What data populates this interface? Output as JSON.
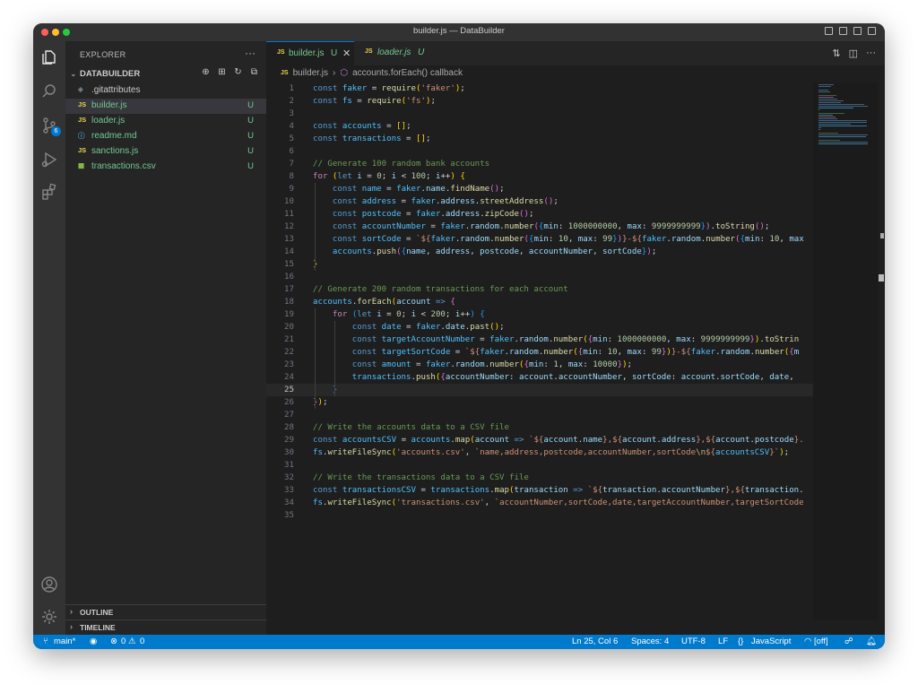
{
  "window": {
    "title": "builder.js — DataBuilder"
  },
  "activity": {
    "scm_badge": "6"
  },
  "sidebar": {
    "header": "EXPLORER",
    "more": "···",
    "folder": "DATABUILDER",
    "files": [
      {
        "name": ".gitattributes",
        "icon": "◈",
        "icon_color": "#6d8086",
        "name_color": "#cccccc",
        "status": ""
      },
      {
        "name": "builder.js",
        "icon": "JS",
        "icon_color": "#e8d44d",
        "name_color": "#73c991",
        "status": "U"
      },
      {
        "name": "loader.js",
        "icon": "JS",
        "icon_color": "#e8d44d",
        "name_color": "#73c991",
        "status": "U"
      },
      {
        "name": "readme.md",
        "icon": "ⓘ",
        "icon_color": "#519aba",
        "name_color": "#73c991",
        "status": "U"
      },
      {
        "name": "sanctions.js",
        "icon": "JS",
        "icon_color": "#e8d44d",
        "name_color": "#73c991",
        "status": "U"
      },
      {
        "name": "transactions.csv",
        "icon": "▦",
        "icon_color": "#8dc149",
        "name_color": "#73c991",
        "status": "U"
      }
    ],
    "outline": "OUTLINE",
    "timeline": "TIMELINE"
  },
  "tabs": [
    {
      "icon": "JS",
      "name": "builder.js",
      "status": "U",
      "close": "✕"
    },
    {
      "icon": "JS",
      "name": "loader.js",
      "status": "U"
    }
  ],
  "breadcrumb": {
    "file_icon": "JS",
    "file": "builder.js",
    "sep": "›",
    "symbol_icon": "⬡",
    "symbol": "accounts.forEach() callback"
  },
  "code": [
    [
      [
        "const ",
        "#569cd6"
      ],
      [
        "faker",
        "#4fc1ff"
      ],
      [
        " = ",
        "#d4d4d4"
      ],
      [
        "require",
        "#dcdcaa"
      ],
      [
        "(",
        "#ffd700"
      ],
      [
        "'faker'",
        "#ce9178"
      ],
      [
        ")",
        "#ffd700"
      ],
      [
        ";",
        "#d4d4d4"
      ]
    ],
    [
      [
        "const ",
        "#569cd6"
      ],
      [
        "fs",
        "#4fc1ff"
      ],
      [
        " = ",
        "#d4d4d4"
      ],
      [
        "require",
        "#dcdcaa"
      ],
      [
        "(",
        "#ffd700"
      ],
      [
        "'fs'",
        "#ce9178"
      ],
      [
        ")",
        "#ffd700"
      ],
      [
        ";",
        "#d4d4d4"
      ]
    ],
    [],
    [
      [
        "const ",
        "#569cd6"
      ],
      [
        "accounts",
        "#4fc1ff"
      ],
      [
        " = ",
        "#d4d4d4"
      ],
      [
        "[]",
        "#ffd700"
      ],
      [
        ";",
        "#d4d4d4"
      ]
    ],
    [
      [
        "const ",
        "#569cd6"
      ],
      [
        "transactions",
        "#4fc1ff"
      ],
      [
        " = ",
        "#d4d4d4"
      ],
      [
        "[]",
        "#ffd700"
      ],
      [
        ";",
        "#d4d4d4"
      ]
    ],
    [],
    [
      [
        "// Generate 100 random bank accounts",
        "#6a9955"
      ]
    ],
    [
      [
        "for ",
        "#c586c0"
      ],
      [
        "(",
        "#ffd700"
      ],
      [
        "let ",
        "#569cd6"
      ],
      [
        "i",
        "#9cdcfe"
      ],
      [
        " = ",
        "#d4d4d4"
      ],
      [
        "0",
        "#b5cea8"
      ],
      [
        "; ",
        "#d4d4d4"
      ],
      [
        "i",
        "#9cdcfe"
      ],
      [
        " < ",
        "#d4d4d4"
      ],
      [
        "100",
        "#b5cea8"
      ],
      [
        "; ",
        "#d4d4d4"
      ],
      [
        "i",
        "#9cdcfe"
      ],
      [
        "++",
        "#d4d4d4"
      ],
      [
        ") ",
        "#ffd700"
      ],
      [
        "{",
        "#ffd700"
      ]
    ],
    [
      [
        "    const ",
        "#569cd6"
      ],
      [
        "name",
        "#4fc1ff"
      ],
      [
        " = ",
        "#d4d4d4"
      ],
      [
        "faker",
        "#4fc1ff"
      ],
      [
        ".",
        "#d4d4d4"
      ],
      [
        "name",
        "#9cdcfe"
      ],
      [
        ".",
        "#d4d4d4"
      ],
      [
        "findName",
        "#dcdcaa"
      ],
      [
        "()",
        "#da70d6"
      ],
      [
        ";",
        "#d4d4d4"
      ]
    ],
    [
      [
        "    const ",
        "#569cd6"
      ],
      [
        "address",
        "#4fc1ff"
      ],
      [
        " = ",
        "#d4d4d4"
      ],
      [
        "faker",
        "#4fc1ff"
      ],
      [
        ".",
        "#d4d4d4"
      ],
      [
        "address",
        "#9cdcfe"
      ],
      [
        ".",
        "#d4d4d4"
      ],
      [
        "streetAddress",
        "#dcdcaa"
      ],
      [
        "()",
        "#da70d6"
      ],
      [
        ";",
        "#d4d4d4"
      ]
    ],
    [
      [
        "    const ",
        "#569cd6"
      ],
      [
        "postcode",
        "#4fc1ff"
      ],
      [
        " = ",
        "#d4d4d4"
      ],
      [
        "faker",
        "#4fc1ff"
      ],
      [
        ".",
        "#d4d4d4"
      ],
      [
        "address",
        "#9cdcfe"
      ],
      [
        ".",
        "#d4d4d4"
      ],
      [
        "zipCode",
        "#dcdcaa"
      ],
      [
        "()",
        "#da70d6"
      ],
      [
        ";",
        "#d4d4d4"
      ]
    ],
    [
      [
        "    const ",
        "#569cd6"
      ],
      [
        "accountNumber",
        "#4fc1ff"
      ],
      [
        " = ",
        "#d4d4d4"
      ],
      [
        "faker",
        "#4fc1ff"
      ],
      [
        ".",
        "#d4d4d4"
      ],
      [
        "random",
        "#9cdcfe"
      ],
      [
        ".",
        "#d4d4d4"
      ],
      [
        "number",
        "#dcdcaa"
      ],
      [
        "(",
        "#da70d6"
      ],
      [
        "{",
        "#179fff"
      ],
      [
        "min",
        "#9cdcfe"
      ],
      [
        ": ",
        "#d4d4d4"
      ],
      [
        "1000000000",
        "#b5cea8"
      ],
      [
        ", ",
        "#d4d4d4"
      ],
      [
        "max",
        "#9cdcfe"
      ],
      [
        ": ",
        "#d4d4d4"
      ],
      [
        "9999999999",
        "#b5cea8"
      ],
      [
        "}",
        "#179fff"
      ],
      [
        ")",
        "#da70d6"
      ],
      [
        ".",
        "#d4d4d4"
      ],
      [
        "toString",
        "#dcdcaa"
      ],
      [
        "()",
        "#da70d6"
      ],
      [
        ";",
        "#d4d4d4"
      ]
    ],
    [
      [
        "    const ",
        "#569cd6"
      ],
      [
        "sortCode",
        "#4fc1ff"
      ],
      [
        " = ",
        "#d4d4d4"
      ],
      [
        "`${",
        "#ce9178"
      ],
      [
        "faker",
        "#4fc1ff"
      ],
      [
        ".",
        "#d4d4d4"
      ],
      [
        "random",
        "#9cdcfe"
      ],
      [
        ".",
        "#d4d4d4"
      ],
      [
        "number",
        "#dcdcaa"
      ],
      [
        "(",
        "#da70d6"
      ],
      [
        "{",
        "#179fff"
      ],
      [
        "min",
        "#9cdcfe"
      ],
      [
        ": ",
        "#d4d4d4"
      ],
      [
        "10",
        "#b5cea8"
      ],
      [
        ", ",
        "#d4d4d4"
      ],
      [
        "max",
        "#9cdcfe"
      ],
      [
        ": ",
        "#d4d4d4"
      ],
      [
        "99",
        "#b5cea8"
      ],
      [
        "}",
        "#179fff"
      ],
      [
        ")",
        "#da70d6"
      ],
      [
        "}-${",
        "#ce9178"
      ],
      [
        "faker",
        "#4fc1ff"
      ],
      [
        ".",
        "#d4d4d4"
      ],
      [
        "random",
        "#9cdcfe"
      ],
      [
        ".",
        "#d4d4d4"
      ],
      [
        "number",
        "#dcdcaa"
      ],
      [
        "(",
        "#da70d6"
      ],
      [
        "{",
        "#179fff"
      ],
      [
        "min",
        "#9cdcfe"
      ],
      [
        ": ",
        "#d4d4d4"
      ],
      [
        "10",
        "#b5cea8"
      ],
      [
        ", ",
        "#d4d4d4"
      ],
      [
        "max",
        "#9cdcfe"
      ]
    ],
    [
      [
        "    accounts",
        "#4fc1ff"
      ],
      [
        ".",
        "#d4d4d4"
      ],
      [
        "push",
        "#dcdcaa"
      ],
      [
        "(",
        "#da70d6"
      ],
      [
        "{",
        "#179fff"
      ],
      [
        "name, address, postcode, accountNumber, sortCode",
        "#9cdcfe"
      ],
      [
        "}",
        "#179fff"
      ],
      [
        ")",
        "#da70d6"
      ],
      [
        ";",
        "#d4d4d4"
      ]
    ],
    [
      [
        "}",
        "#ffd700"
      ]
    ],
    [],
    [
      [
        "// Generate 200 random transactions for each account",
        "#6a9955"
      ]
    ],
    [
      [
        "accounts",
        "#4fc1ff"
      ],
      [
        ".",
        "#d4d4d4"
      ],
      [
        "forEach",
        "#dcdcaa"
      ],
      [
        "(",
        "#ffd700"
      ],
      [
        "account",
        "#9cdcfe"
      ],
      [
        " => ",
        "#569cd6"
      ],
      [
        "{",
        "#da70d6"
      ]
    ],
    [
      [
        "    for ",
        "#c586c0"
      ],
      [
        "(",
        "#179fff"
      ],
      [
        "let ",
        "#569cd6"
      ],
      [
        "i",
        "#9cdcfe"
      ],
      [
        " = ",
        "#d4d4d4"
      ],
      [
        "0",
        "#b5cea8"
      ],
      [
        "; ",
        "#d4d4d4"
      ],
      [
        "i",
        "#9cdcfe"
      ],
      [
        " < ",
        "#d4d4d4"
      ],
      [
        "200",
        "#b5cea8"
      ],
      [
        "; ",
        "#d4d4d4"
      ],
      [
        "i",
        "#9cdcfe"
      ],
      [
        "++",
        "#d4d4d4"
      ],
      [
        ") ",
        "#179fff"
      ],
      [
        "{",
        "#179fff"
      ]
    ],
    [
      [
        "        const ",
        "#569cd6"
      ],
      [
        "date",
        "#4fc1ff"
      ],
      [
        " = ",
        "#d4d4d4"
      ],
      [
        "faker",
        "#4fc1ff"
      ],
      [
        ".",
        "#d4d4d4"
      ],
      [
        "date",
        "#9cdcfe"
      ],
      [
        ".",
        "#d4d4d4"
      ],
      [
        "past",
        "#dcdcaa"
      ],
      [
        "()",
        "#ffd700"
      ],
      [
        ";",
        "#d4d4d4"
      ]
    ],
    [
      [
        "        const ",
        "#569cd6"
      ],
      [
        "targetAccountNumber",
        "#4fc1ff"
      ],
      [
        " = ",
        "#d4d4d4"
      ],
      [
        "faker",
        "#4fc1ff"
      ],
      [
        ".",
        "#d4d4d4"
      ],
      [
        "random",
        "#9cdcfe"
      ],
      [
        ".",
        "#d4d4d4"
      ],
      [
        "number",
        "#dcdcaa"
      ],
      [
        "(",
        "#ffd700"
      ],
      [
        "{",
        "#da70d6"
      ],
      [
        "min",
        "#9cdcfe"
      ],
      [
        ": ",
        "#d4d4d4"
      ],
      [
        "1000000000",
        "#b5cea8"
      ],
      [
        ", ",
        "#d4d4d4"
      ],
      [
        "max",
        "#9cdcfe"
      ],
      [
        ": ",
        "#d4d4d4"
      ],
      [
        "9999999999",
        "#b5cea8"
      ],
      [
        "}",
        "#da70d6"
      ],
      [
        ")",
        "#ffd700"
      ],
      [
        ".",
        "#d4d4d4"
      ],
      [
        "toStrin",
        "#dcdcaa"
      ]
    ],
    [
      [
        "        const ",
        "#569cd6"
      ],
      [
        "targetSortCode",
        "#4fc1ff"
      ],
      [
        " = ",
        "#d4d4d4"
      ],
      [
        "`${",
        "#ce9178"
      ],
      [
        "faker",
        "#4fc1ff"
      ],
      [
        ".",
        "#d4d4d4"
      ],
      [
        "random",
        "#9cdcfe"
      ],
      [
        ".",
        "#d4d4d4"
      ],
      [
        "number",
        "#dcdcaa"
      ],
      [
        "(",
        "#ffd700"
      ],
      [
        "{",
        "#da70d6"
      ],
      [
        "min",
        "#9cdcfe"
      ],
      [
        ": ",
        "#d4d4d4"
      ],
      [
        "10",
        "#b5cea8"
      ],
      [
        ", ",
        "#d4d4d4"
      ],
      [
        "max",
        "#9cdcfe"
      ],
      [
        ": ",
        "#d4d4d4"
      ],
      [
        "99",
        "#b5cea8"
      ],
      [
        "}",
        "#da70d6"
      ],
      [
        ")",
        "#ffd700"
      ],
      [
        "}-${",
        "#ce9178"
      ],
      [
        "faker",
        "#4fc1ff"
      ],
      [
        ".",
        "#d4d4d4"
      ],
      [
        "random",
        "#9cdcfe"
      ],
      [
        ".",
        "#d4d4d4"
      ],
      [
        "number",
        "#dcdcaa"
      ],
      [
        "(",
        "#ffd700"
      ],
      [
        "{",
        "#da70d6"
      ],
      [
        "m",
        "#9cdcfe"
      ]
    ],
    [
      [
        "        const ",
        "#569cd6"
      ],
      [
        "amount",
        "#4fc1ff"
      ],
      [
        " = ",
        "#d4d4d4"
      ],
      [
        "faker",
        "#4fc1ff"
      ],
      [
        ".",
        "#d4d4d4"
      ],
      [
        "random",
        "#9cdcfe"
      ],
      [
        ".",
        "#d4d4d4"
      ],
      [
        "number",
        "#dcdcaa"
      ],
      [
        "(",
        "#ffd700"
      ],
      [
        "{",
        "#da70d6"
      ],
      [
        "min",
        "#9cdcfe"
      ],
      [
        ": ",
        "#d4d4d4"
      ],
      [
        "1",
        "#b5cea8"
      ],
      [
        ", ",
        "#d4d4d4"
      ],
      [
        "max",
        "#9cdcfe"
      ],
      [
        ": ",
        "#d4d4d4"
      ],
      [
        "10000",
        "#b5cea8"
      ],
      [
        "}",
        "#da70d6"
      ],
      [
        ")",
        "#ffd700"
      ],
      [
        ";",
        "#d4d4d4"
      ]
    ],
    [
      [
        "        transactions",
        "#4fc1ff"
      ],
      [
        ".",
        "#d4d4d4"
      ],
      [
        "push",
        "#dcdcaa"
      ],
      [
        "(",
        "#ffd700"
      ],
      [
        "{",
        "#da70d6"
      ],
      [
        "accountNumber",
        "#9cdcfe"
      ],
      [
        ": ",
        "#d4d4d4"
      ],
      [
        "account",
        "#9cdcfe"
      ],
      [
        ".",
        "#d4d4d4"
      ],
      [
        "accountNumber",
        "#9cdcfe"
      ],
      [
        ", ",
        "#d4d4d4"
      ],
      [
        "sortCode",
        "#9cdcfe"
      ],
      [
        ": ",
        "#d4d4d4"
      ],
      [
        "account",
        "#9cdcfe"
      ],
      [
        ".",
        "#d4d4d4"
      ],
      [
        "sortCode",
        "#9cdcfe"
      ],
      [
        ", ",
        "#d4d4d4"
      ],
      [
        "date",
        "#9cdcfe"
      ],
      [
        ", ",
        "#d4d4d4"
      ]
    ],
    [
      [
        "    }",
        "#179fff"
      ]
    ],
    [
      [
        "}",
        "#da70d6"
      ],
      [
        ")",
        "#ffd700"
      ],
      [
        ";",
        "#d4d4d4"
      ]
    ],
    [],
    [
      [
        "// Write the accounts data to a CSV file",
        "#6a9955"
      ]
    ],
    [
      [
        "const ",
        "#569cd6"
      ],
      [
        "accountsCSV",
        "#4fc1ff"
      ],
      [
        " = ",
        "#d4d4d4"
      ],
      [
        "accounts",
        "#4fc1ff"
      ],
      [
        ".",
        "#d4d4d4"
      ],
      [
        "map",
        "#dcdcaa"
      ],
      [
        "(",
        "#ffd700"
      ],
      [
        "account",
        "#9cdcfe"
      ],
      [
        " => ",
        "#569cd6"
      ],
      [
        "`${",
        "#ce9178"
      ],
      [
        "account",
        "#9cdcfe"
      ],
      [
        ".",
        "#d4d4d4"
      ],
      [
        "name",
        "#9cdcfe"
      ],
      [
        "},${",
        "#ce9178"
      ],
      [
        "account",
        "#9cdcfe"
      ],
      [
        ".",
        "#d4d4d4"
      ],
      [
        "address",
        "#9cdcfe"
      ],
      [
        "},${",
        "#ce9178"
      ],
      [
        "account",
        "#9cdcfe"
      ],
      [
        ".",
        "#d4d4d4"
      ],
      [
        "postcode",
        "#9cdcfe"
      ],
      [
        "}.",
        "#ce9178"
      ]
    ],
    [
      [
        "fs",
        "#4fc1ff"
      ],
      [
        ".",
        "#d4d4d4"
      ],
      [
        "writeFileSync",
        "#dcdcaa"
      ],
      [
        "(",
        "#ffd700"
      ],
      [
        "'accounts.csv'",
        "#ce9178"
      ],
      [
        ", ",
        "#d4d4d4"
      ],
      [
        "`name,address,postcode,accountNumber,sortCode",
        "#ce9178"
      ],
      [
        "\\n",
        "#d7ba7d"
      ],
      [
        "${",
        "#ce9178"
      ],
      [
        "accountsCSV",
        "#4fc1ff"
      ],
      [
        "}`",
        "#ce9178"
      ],
      [
        ")",
        "#ffd700"
      ],
      [
        ";",
        "#d4d4d4"
      ]
    ],
    [],
    [
      [
        "// Write the transactions data to a CSV file",
        "#6a9955"
      ]
    ],
    [
      [
        "const ",
        "#569cd6"
      ],
      [
        "transactionsCSV",
        "#4fc1ff"
      ],
      [
        " = ",
        "#d4d4d4"
      ],
      [
        "transactions",
        "#4fc1ff"
      ],
      [
        ".",
        "#d4d4d4"
      ],
      [
        "map",
        "#dcdcaa"
      ],
      [
        "(",
        "#ffd700"
      ],
      [
        "transaction",
        "#9cdcfe"
      ],
      [
        " => ",
        "#569cd6"
      ],
      [
        "`${",
        "#ce9178"
      ],
      [
        "transaction",
        "#9cdcfe"
      ],
      [
        ".",
        "#d4d4d4"
      ],
      [
        "accountNumber",
        "#9cdcfe"
      ],
      [
        "},${",
        "#ce9178"
      ],
      [
        "transaction.",
        "#9cdcfe"
      ]
    ],
    [
      [
        "fs",
        "#4fc1ff"
      ],
      [
        ".",
        "#d4d4d4"
      ],
      [
        "writeFileSync",
        "#dcdcaa"
      ],
      [
        "(",
        "#ffd700"
      ],
      [
        "'transactions.csv'",
        "#ce9178"
      ],
      [
        ", ",
        "#d4d4d4"
      ],
      [
        "`accountNumber,sortCode,date,targetAccountNumber,targetSortCode",
        "#ce9178"
      ]
    ],
    []
  ],
  "current_line": 25,
  "status": {
    "branch": "main*",
    "errors": "0",
    "warnings": "0",
    "position": "Ln 25, Col 6",
    "spaces": "Spaces: 4",
    "encoding": "UTF-8",
    "eol": "LF",
    "language": "JavaScript",
    "copilot": "[off]"
  }
}
